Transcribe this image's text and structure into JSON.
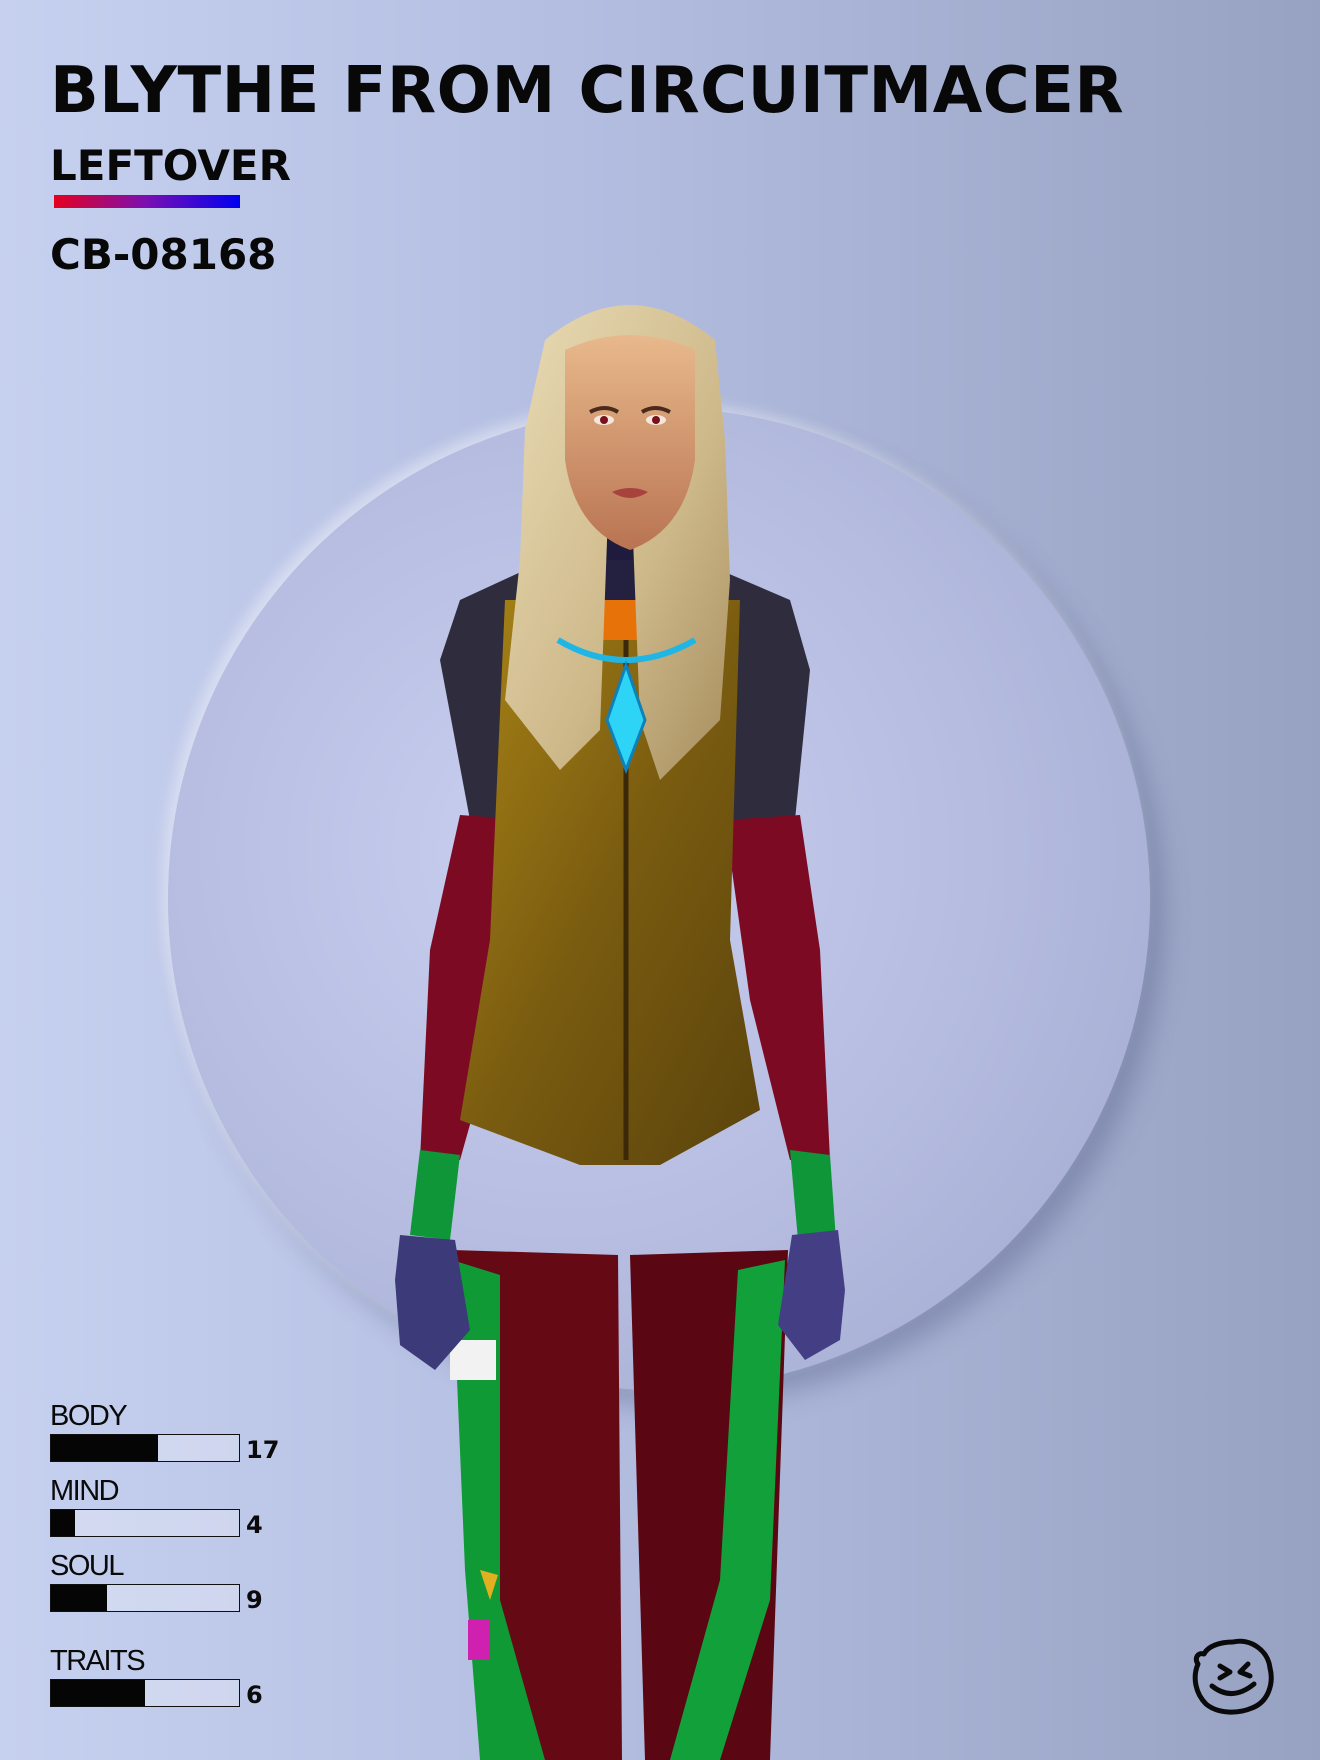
{
  "card": {
    "title": "BLYTHE FROM CIRCUITMACER",
    "subtitle": "LEFTOVER",
    "code": "CB-08168"
  },
  "colors": {
    "accent_start": "#e4001f",
    "accent_end": "#0000ef",
    "vest": "#9a7a12",
    "sleeves": "#7c0a22",
    "leg_panels": "#0d9a35",
    "gloves": "#3c3a78"
  },
  "stats": [
    {
      "label": "BODY",
      "value": "17",
      "fill_pct": 57
    },
    {
      "label": "MIND",
      "value": "4",
      "fill_pct": 13
    },
    {
      "label": "SOUL",
      "value": "9",
      "fill_pct": 30
    },
    {
      "label": "TRAITS",
      "value": "6",
      "fill_pct": 50
    }
  ],
  "icons": {
    "brand_logo": "smiling-face-logo-icon"
  }
}
